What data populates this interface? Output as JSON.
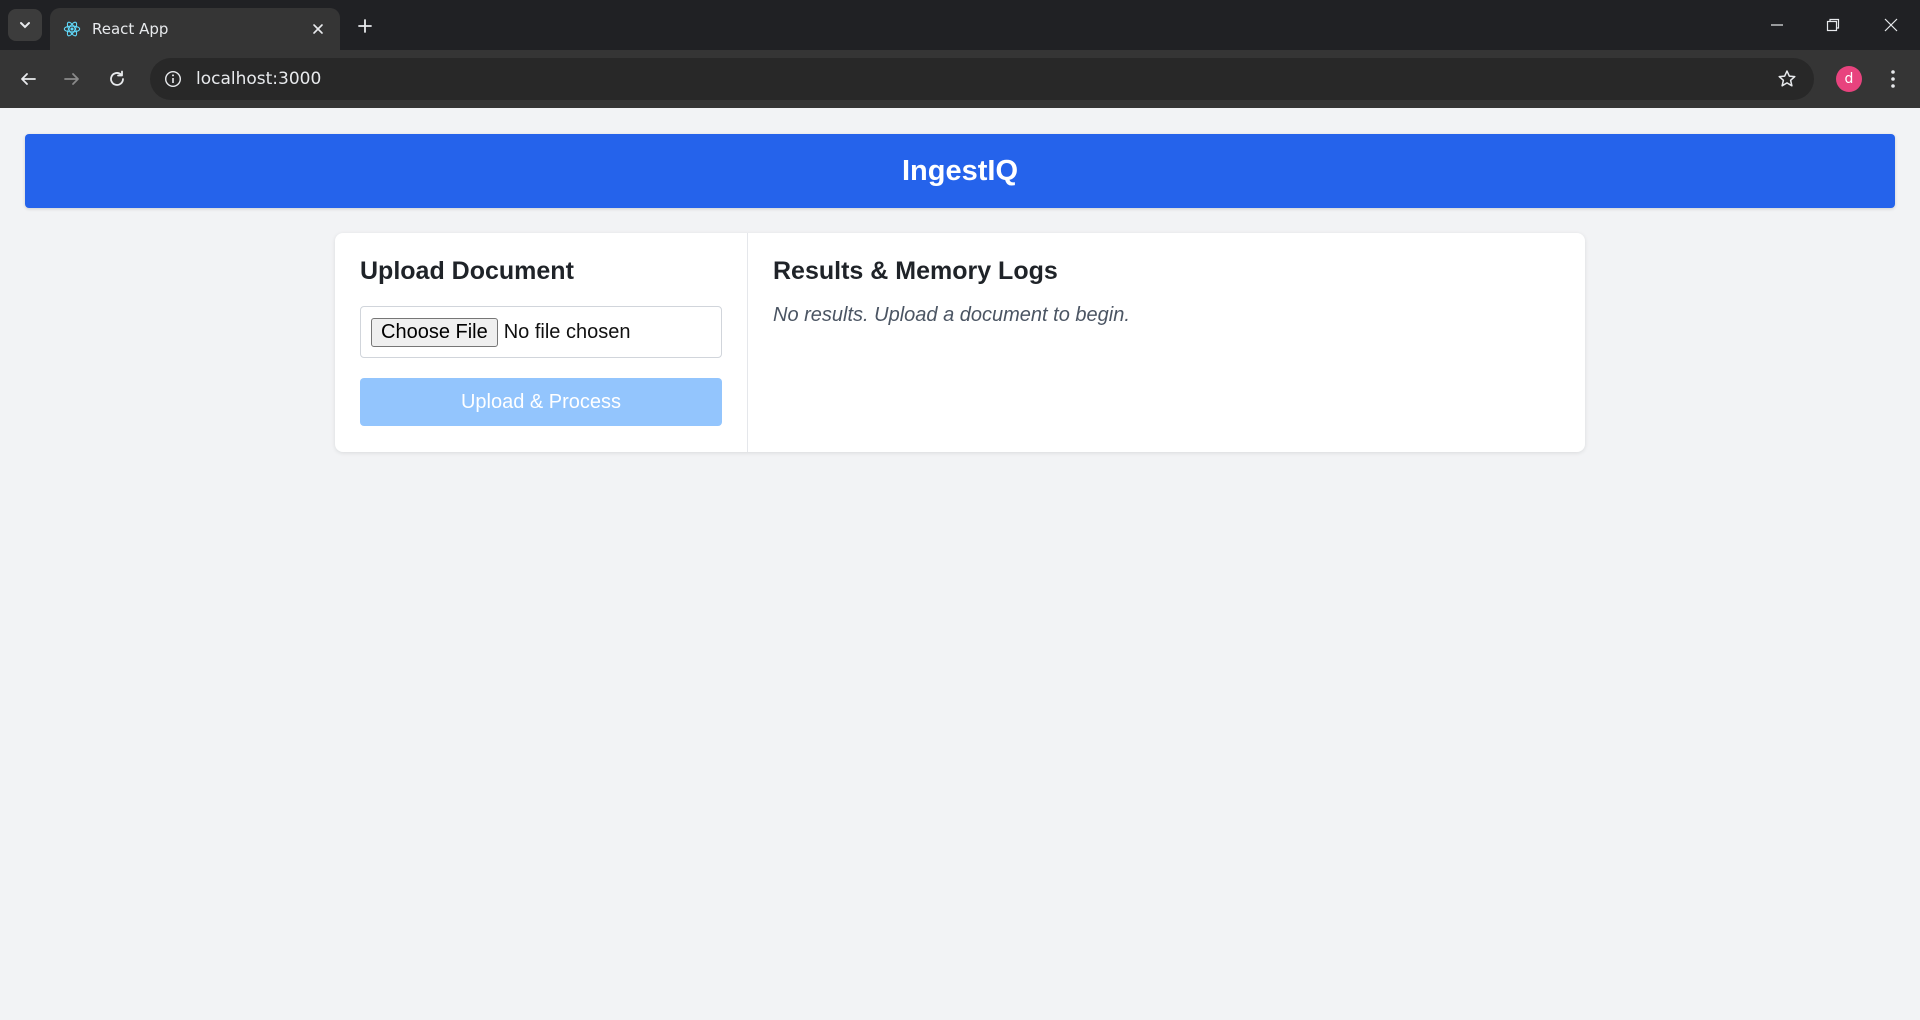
{
  "browser": {
    "tab_title": "React App",
    "url": "localhost:3000",
    "profile_initial": "d"
  },
  "app": {
    "title": "IngestIQ"
  },
  "upload_panel": {
    "title": "Upload Document",
    "choose_file_label": "Choose File",
    "file_status": "No file chosen",
    "submit_label": "Upload & Process"
  },
  "results_panel": {
    "title": "Results & Memory Logs",
    "empty_message": "No results. Upload a document to begin."
  },
  "colors": {
    "header_bg": "#2563eb",
    "button_disabled_bg": "#93c5fd",
    "page_bg": "#f2f3f5"
  }
}
